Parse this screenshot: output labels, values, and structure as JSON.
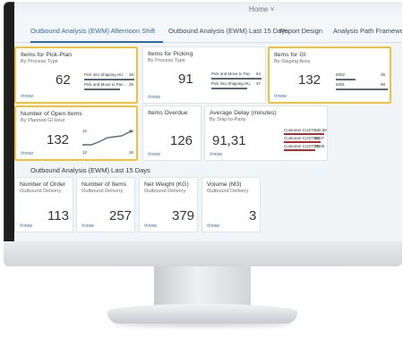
{
  "header": {
    "home_label": "Home ˅"
  },
  "tabs": [
    {
      "label": "Outbound Analysis (EWM) Afternoon Shift",
      "active": true
    },
    {
      "label": "Outbound Analysis (EWM) Last 15 Days",
      "active": false
    },
    {
      "label": "Report Design",
      "active": false
    },
    {
      "label": "Analysis Path Framewo",
      "active": false
    }
  ],
  "group1": {
    "tiles": [
      {
        "title": "Items for Pick-Plan",
        "subtitle": "By Process Type",
        "value": "62",
        "footer": "now",
        "bars": [
          {
            "label": "Pick into Shipping HU",
            "value": "36"
          },
          {
            "label": "Pick and Move to Pac...",
            "value": "26"
          }
        ]
      },
      {
        "title": "Items for Picking",
        "subtitle": "By Process Type",
        "value": "91",
        "footer": "now",
        "bars": [
          {
            "label": "Pick and Move to Pac",
            "value": "54"
          },
          {
            "label": "Pick into Shipping HU",
            "value": "37"
          }
        ]
      },
      {
        "title": "Items for GI",
        "subtitle": "By Staging Area",
        "value": "132",
        "footer": "now",
        "bars": [
          {
            "label": "5002",
            "value": "35"
          },
          {
            "label": "5001",
            "value": "98"
          }
        ]
      },
      {
        "title": "Number of Open Items",
        "subtitle": "By Planned GI Hour",
        "value": "132",
        "footer": "now",
        "spark": {
          "y_top": "16",
          "y_bottom": "12",
          "x_left": "12",
          "x_right": "16"
        }
      },
      {
        "title": "Items Overdue",
        "subtitle": "",
        "value": "126",
        "footer": "now"
      },
      {
        "title": "Average Delay (minutes)",
        "subtitle": "By Ship-to-Party",
        "value": "91,31",
        "footer": "now",
        "rows": [
          {
            "label": "Customer CUST0...",
            "value": "100.58"
          },
          {
            "label": "Customer CUST004",
            "value": "92.07"
          },
          {
            "label": "Customer CUST002",
            "value": "78.05"
          }
        ]
      }
    ]
  },
  "group2": {
    "title": "Outbound Analysis (EWM) Last 15 Days",
    "tiles": [
      {
        "title": "Number of Order",
        "subtitle": "Outbound Delivery",
        "value": "113",
        "footer": "now"
      },
      {
        "title": "Number of Items",
        "subtitle": "Outbound Delivery",
        "value": "257",
        "footer": "now"
      },
      {
        "title": "Net Weight (KG)",
        "subtitle": "Outbound Delivery",
        "value": "379",
        "footer": "now"
      },
      {
        "title": "Volume (M3)",
        "subtitle": "Outbound Delivery",
        "value": "3",
        "footer": "now"
      }
    ]
  },
  "colors": {
    "accent": "#2d6ca2",
    "selection": "#f0c23a",
    "alert": "#c0282b"
  }
}
